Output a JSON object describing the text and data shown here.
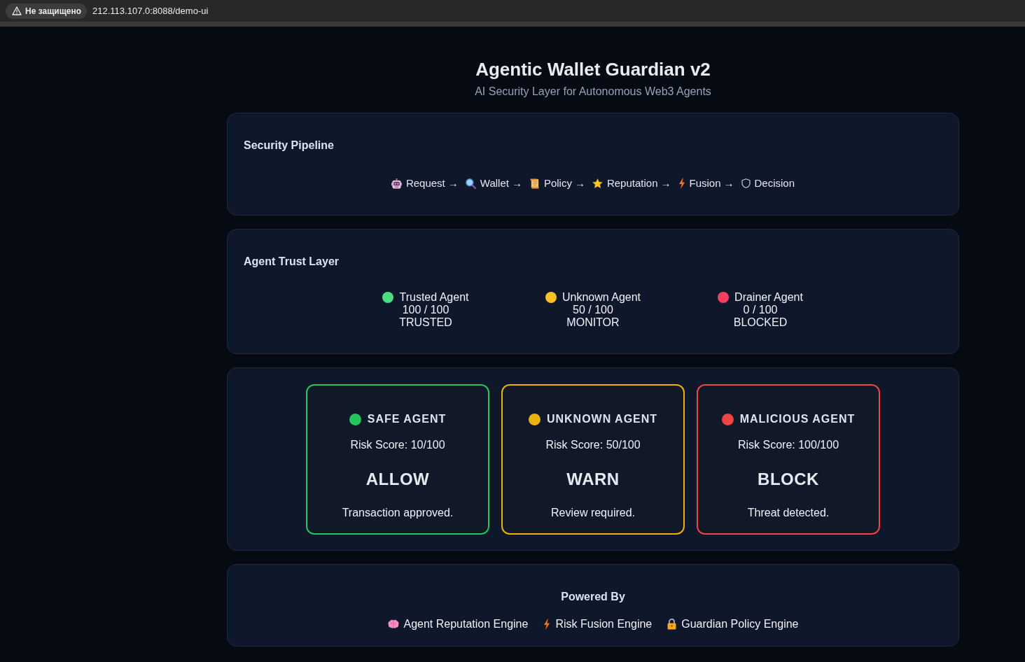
{
  "browser": {
    "security_label": "Не защищено",
    "url": "212.113.107.0:8088/demo-ui"
  },
  "header": {
    "title": "Agentic Wallet Guardian v2",
    "subtitle": "AI Security Layer for Autonomous Web3 Agents"
  },
  "pipeline": {
    "title": "Security Pipeline",
    "steps": [
      {
        "label": "Request",
        "separator": "→"
      },
      {
        "label": "Wallet",
        "separator": "→"
      },
      {
        "label": "Policy",
        "separator": "→"
      },
      {
        "label": "Reputation",
        "separator": "→"
      },
      {
        "label": "Fusion",
        "separator": "→"
      },
      {
        "label": "Decision"
      }
    ]
  },
  "trust_layer": {
    "title": "Agent Trust Layer",
    "agents": [
      {
        "name": "Trusted Agent",
        "score": "100 / 100",
        "status": "TRUSTED",
        "color": "#4ade80"
      },
      {
        "name": "Unknown Agent",
        "score": "50 / 100",
        "status": "MONITOR",
        "color": "#fbbf24"
      },
      {
        "name": "Drainer Agent",
        "score": "0 / 100",
        "status": "BLOCKED",
        "color": "#f43f5e"
      }
    ]
  },
  "decisions": [
    {
      "title": "SAFE AGENT",
      "risk_score": "Risk Score: 10/100",
      "verdict": "ALLOW",
      "message": "Transaction approved.",
      "color": "#22c55e"
    },
    {
      "title": "UNKNOWN AGENT",
      "risk_score": "Risk Score: 50/100",
      "verdict": "WARN",
      "message": "Review required.",
      "color": "#eab308"
    },
    {
      "title": "MALICIOUS AGENT",
      "risk_score": "Risk Score: 100/100",
      "verdict": "BLOCK",
      "message": "Threat detected.",
      "color": "#ef4444"
    }
  ],
  "powered_by": {
    "title": "Powered By",
    "engines": [
      {
        "label": "Agent Reputation Engine"
      },
      {
        "label": "Risk Fusion Engine"
      },
      {
        "label": "Guardian Policy Engine"
      }
    ]
  }
}
